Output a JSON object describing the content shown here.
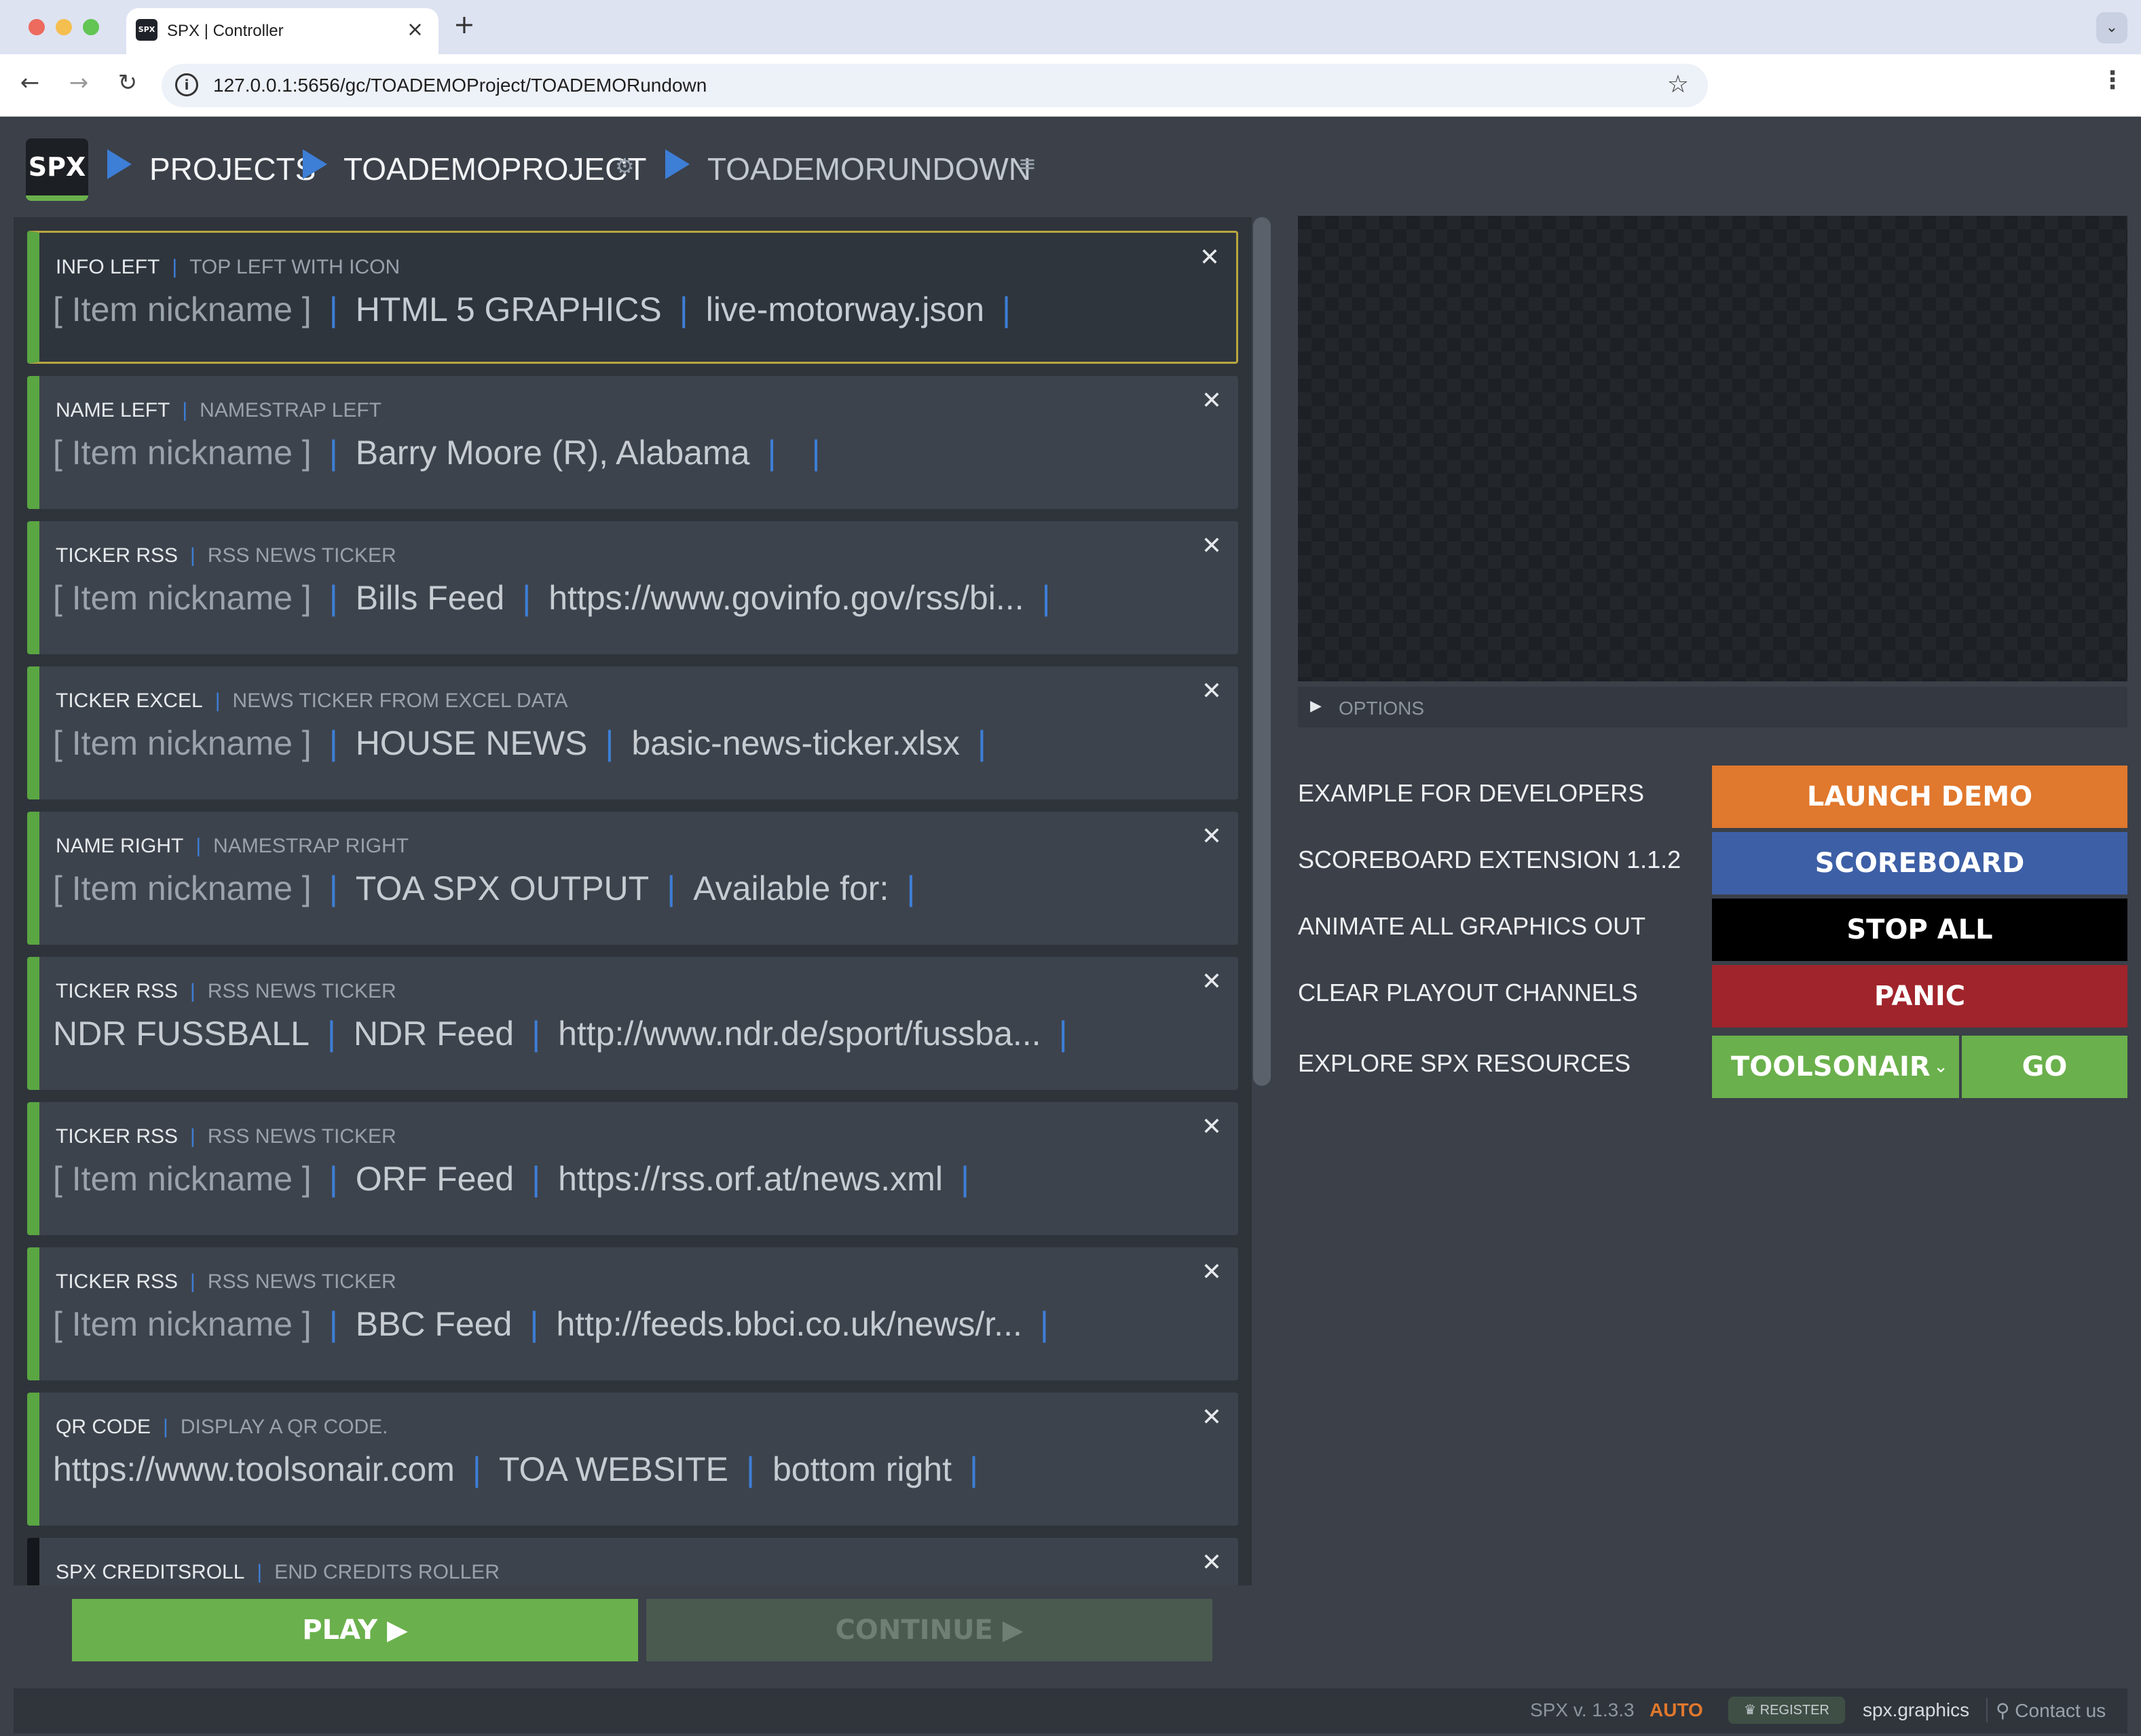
{
  "browser": {
    "tab_title": "SPX | Controller",
    "url": "127.0.0.1:5656/gc/TOADEMOProject/TOADEMORundown",
    "favicon_text": "SPX"
  },
  "header": {
    "logo": "SPX",
    "crumbs": [
      "PROJECTS",
      "TOADEMOPROJECT",
      "TOADEMORUNDOWN"
    ]
  },
  "rundown": {
    "items": [
      {
        "type": "INFO LEFT",
        "desc": "TOP LEFT WITH ICON",
        "f1": "[ Item nickname ]",
        "f2": "HTML 5 GRAPHICS",
        "f3": "live-motorway.json"
      },
      {
        "type": "NAME LEFT",
        "desc": "NAMESTRAP LEFT",
        "f1": "[ Item nickname ]",
        "f2": "Barry Moore (R), Alabama",
        "f3": ""
      },
      {
        "type": "TICKER RSS",
        "desc": "RSS NEWS TICKER",
        "f1": "[ Item nickname ]",
        "f2": "Bills Feed",
        "f3": "https://www.govinfo.gov/rss/bi..."
      },
      {
        "type": "TICKER EXCEL",
        "desc": "NEWS TICKER FROM EXCEL DATA",
        "f1": "[ Item nickname ]",
        "f2": "HOUSE NEWS",
        "f3": "basic-news-ticker.xlsx"
      },
      {
        "type": "NAME RIGHT",
        "desc": "NAMESTRAP RIGHT",
        "f1": "[ Item nickname ]",
        "f2": "TOA SPX OUTPUT",
        "f3": "Available for:"
      },
      {
        "type": "TICKER RSS",
        "desc": "RSS NEWS TICKER",
        "f1": "NDR FUSSBALL",
        "f2": "NDR Feed",
        "f3": "http://www.ndr.de/sport/fussba..."
      },
      {
        "type": "TICKER RSS",
        "desc": "RSS NEWS TICKER",
        "f1": "[ Item nickname ]",
        "f2": "ORF Feed",
        "f3": "https://rss.orf.at/news.xml"
      },
      {
        "type": "TICKER RSS",
        "desc": "RSS NEWS TICKER",
        "f1": "[ Item nickname ]",
        "f2": "BBC Feed",
        "f3": "http://feeds.bbci.co.uk/news/r..."
      },
      {
        "type": "QR CODE",
        "desc": "DISPLAY A QR CODE.",
        "f1": "https://www.toolsonair.com",
        "f2": "TOA WEBSITE",
        "f3": "bottom right"
      },
      {
        "type": "SPX CREDITSROLL",
        "desc": "END CREDITS ROLLER"
      }
    ]
  },
  "controls": {
    "play": "PLAY ▶",
    "continue": "CONTINUE ▶"
  },
  "preview": {
    "options_label": "OPTIONS"
  },
  "extensions": {
    "rows": [
      {
        "label": "EXAMPLE FOR DEVELOPERS",
        "button": "LAUNCH DEMO"
      },
      {
        "label": "SCOREBOARD EXTENSION 1.1.2",
        "button": "SCOREBOARD"
      },
      {
        "label": "ANIMATE ALL GRAPHICS OUT",
        "button": "STOP ALL"
      },
      {
        "label": "CLEAR PLAYOUT CHANNELS",
        "button": "PANIC"
      },
      {
        "label": "EXPLORE SPX RESOURCES",
        "select": "TOOLSONAIR",
        "button": "GO"
      }
    ]
  },
  "footer": {
    "version": "SPX v. 1.3.3",
    "mode": "AUTO",
    "register": "REGISTER",
    "site": "spx.graphics",
    "contact": "Contact us"
  },
  "colors": {
    "accent_blue": "#3d7ed6",
    "green": "#6ab04c",
    "orange": "#e0782d",
    "panic_red": "#a0242b",
    "scoreboard_blue": "#3d5fa6"
  }
}
